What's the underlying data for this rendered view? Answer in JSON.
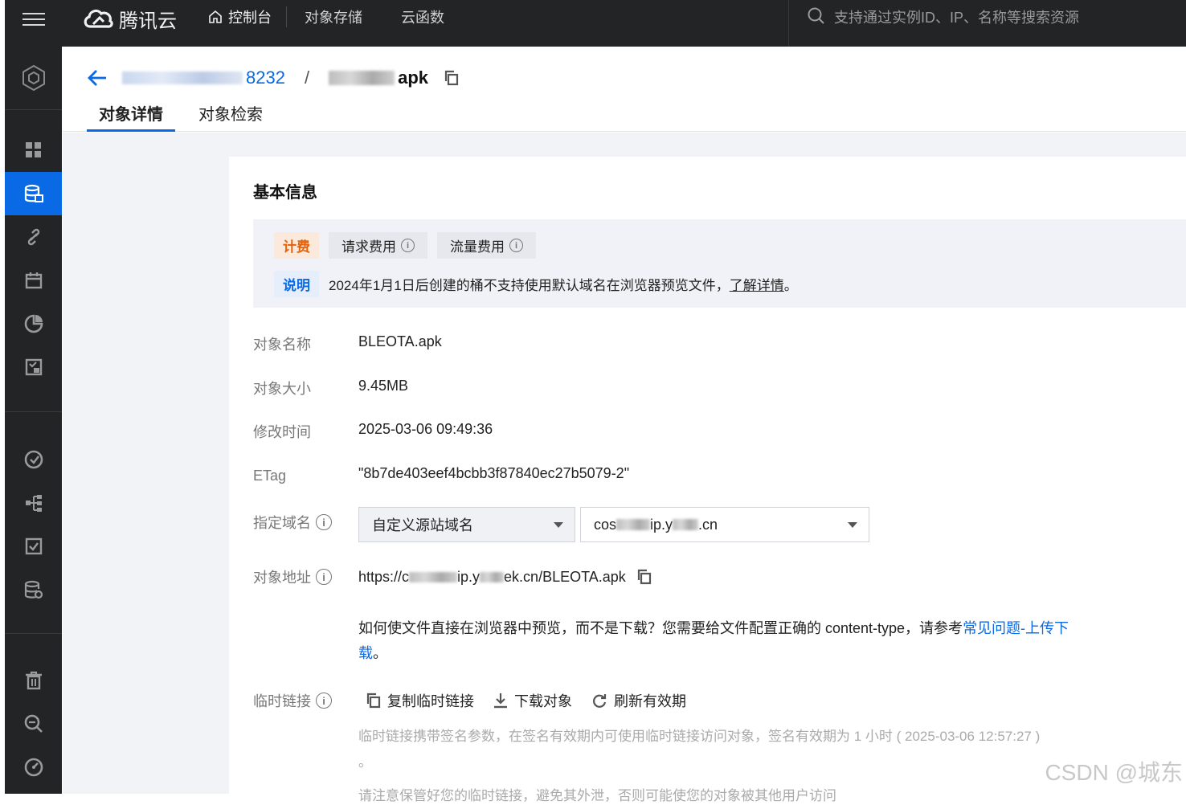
{
  "topbar": {
    "brand": "腾讯云",
    "home_label": "控制台",
    "nav": [
      "对象存储",
      "云函数"
    ],
    "search_placeholder": "支持通过实例ID、IP、名称等搜索资源"
  },
  "breadcrumb": {
    "bucket_suffix": "8232",
    "separator": "/",
    "object_suffix": "apk"
  },
  "tabs": [
    "对象详情",
    "对象检索"
  ],
  "section_title": "基本信息",
  "notice": {
    "billing_tag": "计费",
    "request_fee": "请求费用",
    "traffic_fee": "流量费用",
    "note_tag": "说明",
    "note_text": "2024年1月1日后创建的桶不支持使用默认域名在浏览器预览文件，",
    "note_link": "了解详情",
    "note_end": "。"
  },
  "fields": {
    "name_label": "对象名称",
    "name_value": "BLEOTA.apk",
    "size_label": "对象大小",
    "size_value": "9.45MB",
    "mtime_label": "修改时间",
    "mtime_value": "2025-03-06 09:49:36",
    "etag_label": "ETag",
    "etag_value": "\"8b7de403eef4bcbb3f87840ec27b5079-2\"",
    "domain_label": "指定域名",
    "domain_type": "自定义源站域名",
    "domain_prefix": "cos",
    "domain_mid": "ip.y",
    "domain_suffix": ".cn",
    "url_label": "对象地址",
    "url_prefix": "https://c",
    "url_mid": "ip.y",
    "url_suffix": "ek.cn/BLEOTA.apk",
    "preview_tip": "如何使文件直接在浏览器中预览，而不是下载？您需要给文件配置正确的 content-type，请参考",
    "preview_link": "常见问题-上传下载",
    "preview_end": "。",
    "temp_label": "临时链接",
    "copy_temp": "复制临时链接",
    "download": "下载对象",
    "refresh": "刷新有效期",
    "temp_desc": "临时链接携带签名参数，在签名有效期内可使用临时链接访问对象，签名有效期为 1 小时 ( 2025-03-06 12:57:27 )",
    "temp_desc_end": "。",
    "temp_warn": "请注意保管好您的临时链接，避免其外泄，否则可能使您的对象被其他用户访问"
  },
  "watermark": "CSDN @城东",
  "colors": {
    "accent": "#0a6ae6",
    "dark": "#232426",
    "billing": "#e0620e"
  }
}
